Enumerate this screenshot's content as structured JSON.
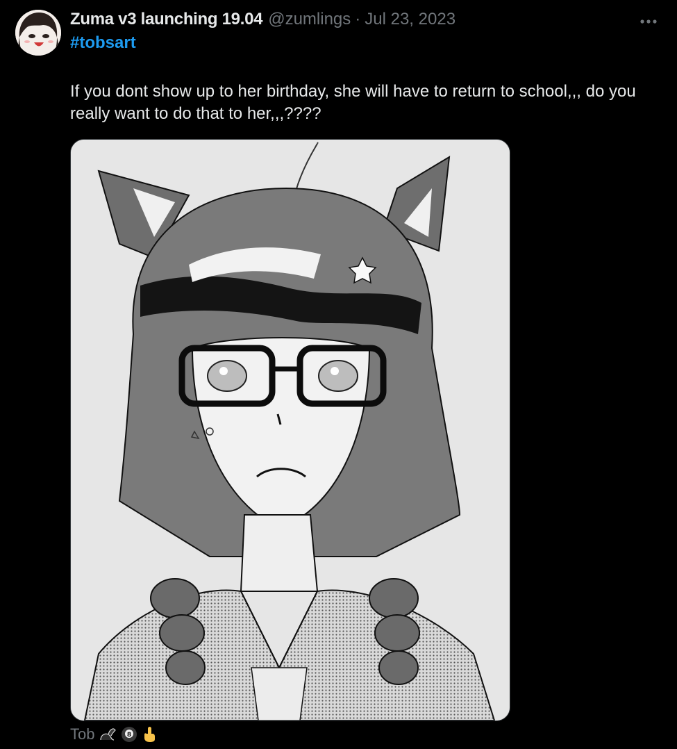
{
  "tweet": {
    "display_name": "Zuma v3 launching 19.04",
    "handle": "@zumlings",
    "separator": "·",
    "date": "Jul 23, 2023",
    "hashtag": "#tobsart",
    "text": "If you dont show up to her birthday, she will have to return to school,,, do you really want to do that to her,,,????",
    "more_icon": "more-horizontal-icon",
    "caption": {
      "text": "Tob",
      "emojis": [
        "skunk-emoji",
        "eight-ball-emoji",
        "finger-emoji"
      ]
    }
  },
  "colors": {
    "background": "#000000",
    "text_primary": "#e7e9ea",
    "text_secondary": "#71767b",
    "link": "#1d9bf0"
  }
}
